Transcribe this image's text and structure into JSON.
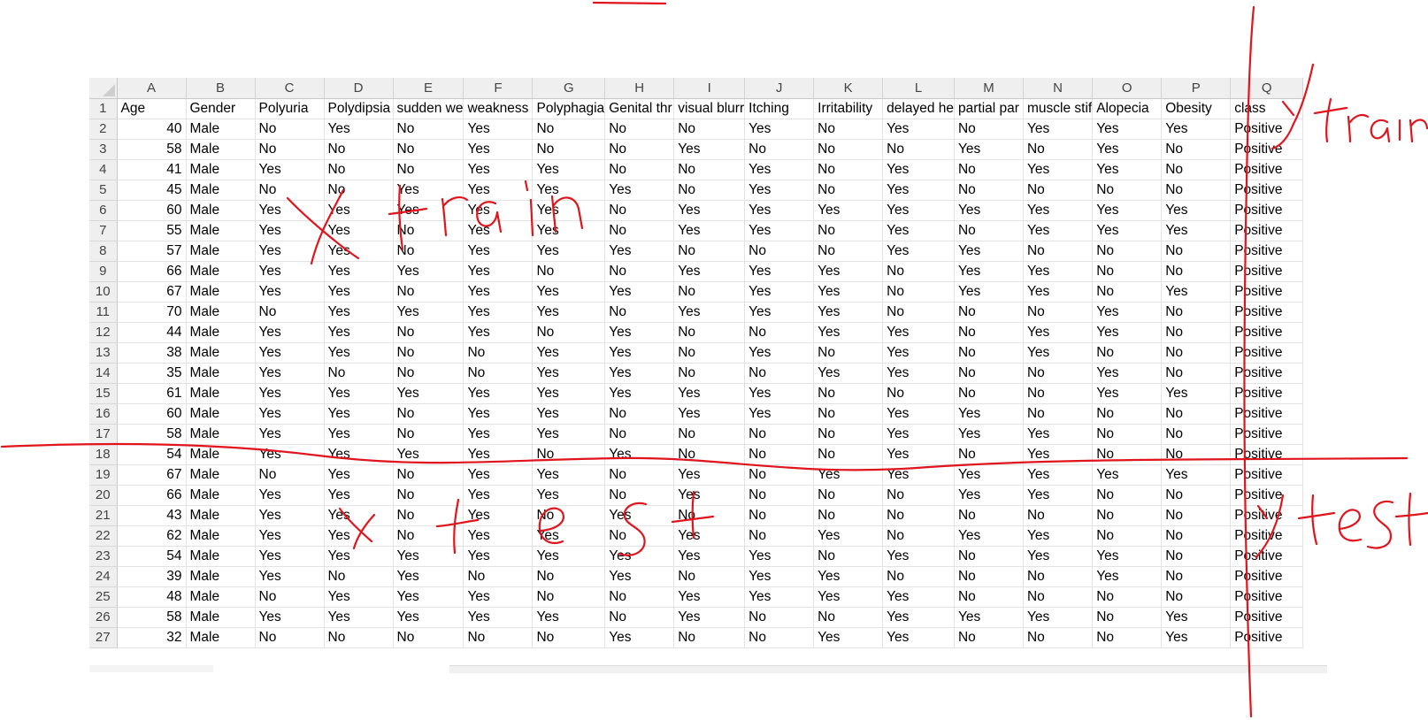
{
  "columns": [
    "A",
    "B",
    "C",
    "D",
    "E",
    "F",
    "G",
    "H",
    "I",
    "J",
    "K",
    "L",
    "M",
    "N",
    "O",
    "P",
    "Q"
  ],
  "header_row": [
    "Age",
    "Gender",
    "Polyuria",
    "Polydipsia",
    "sudden we",
    "weakness",
    "Polyphagia",
    "Genital thr",
    "visual blurr",
    "Itching",
    "Irritability",
    "delayed he",
    "partial par",
    "muscle stif",
    "Alopecia",
    "Obesity",
    "class"
  ],
  "rows": [
    [
      "40",
      "Male",
      "No",
      "Yes",
      "No",
      "Yes",
      "No",
      "No",
      "No",
      "Yes",
      "No",
      "Yes",
      "No",
      "Yes",
      "Yes",
      "Yes",
      "Positive"
    ],
    [
      "58",
      "Male",
      "No",
      "No",
      "No",
      "Yes",
      "No",
      "No",
      "Yes",
      "No",
      "No",
      "No",
      "Yes",
      "No",
      "Yes",
      "No",
      "Positive"
    ],
    [
      "41",
      "Male",
      "Yes",
      "No",
      "No",
      "Yes",
      "Yes",
      "No",
      "No",
      "Yes",
      "No",
      "Yes",
      "No",
      "Yes",
      "Yes",
      "No",
      "Positive"
    ],
    [
      "45",
      "Male",
      "No",
      "No",
      "Yes",
      "Yes",
      "Yes",
      "Yes",
      "No",
      "Yes",
      "No",
      "Yes",
      "No",
      "No",
      "No",
      "No",
      "Positive"
    ],
    [
      "60",
      "Male",
      "Yes",
      "Yes",
      "Yes",
      "Yes",
      "Yes",
      "No",
      "Yes",
      "Yes",
      "Yes",
      "Yes",
      "Yes",
      "Yes",
      "Yes",
      "Yes",
      "Positive"
    ],
    [
      "55",
      "Male",
      "Yes",
      "Yes",
      "No",
      "Yes",
      "Yes",
      "No",
      "Yes",
      "Yes",
      "No",
      "Yes",
      "No",
      "Yes",
      "Yes",
      "Yes",
      "Positive"
    ],
    [
      "57",
      "Male",
      "Yes",
      "Yes",
      "No",
      "Yes",
      "Yes",
      "Yes",
      "No",
      "No",
      "No",
      "Yes",
      "Yes",
      "No",
      "No",
      "No",
      "Positive"
    ],
    [
      "66",
      "Male",
      "Yes",
      "Yes",
      "Yes",
      "Yes",
      "No",
      "No",
      "Yes",
      "Yes",
      "Yes",
      "No",
      "Yes",
      "Yes",
      "No",
      "No",
      "Positive"
    ],
    [
      "67",
      "Male",
      "Yes",
      "Yes",
      "No",
      "Yes",
      "Yes",
      "Yes",
      "No",
      "Yes",
      "Yes",
      "No",
      "Yes",
      "Yes",
      "No",
      "Yes",
      "Positive"
    ],
    [
      "70",
      "Male",
      "No",
      "Yes",
      "Yes",
      "Yes",
      "Yes",
      "No",
      "Yes",
      "Yes",
      "Yes",
      "No",
      "No",
      "No",
      "Yes",
      "No",
      "Positive"
    ],
    [
      "44",
      "Male",
      "Yes",
      "Yes",
      "No",
      "Yes",
      "No",
      "Yes",
      "No",
      "No",
      "Yes",
      "Yes",
      "No",
      "Yes",
      "Yes",
      "No",
      "Positive"
    ],
    [
      "38",
      "Male",
      "Yes",
      "Yes",
      "No",
      "No",
      "Yes",
      "Yes",
      "No",
      "Yes",
      "No",
      "Yes",
      "No",
      "Yes",
      "No",
      "No",
      "Positive"
    ],
    [
      "35",
      "Male",
      "Yes",
      "No",
      "No",
      "No",
      "Yes",
      "Yes",
      "No",
      "No",
      "Yes",
      "Yes",
      "No",
      "No",
      "Yes",
      "No",
      "Positive"
    ],
    [
      "61",
      "Male",
      "Yes",
      "Yes",
      "Yes",
      "Yes",
      "Yes",
      "Yes",
      "Yes",
      "Yes",
      "No",
      "No",
      "No",
      "No",
      "Yes",
      "Yes",
      "Positive"
    ],
    [
      "60",
      "Male",
      "Yes",
      "Yes",
      "No",
      "Yes",
      "Yes",
      "No",
      "Yes",
      "Yes",
      "No",
      "Yes",
      "Yes",
      "No",
      "No",
      "No",
      "Positive"
    ],
    [
      "58",
      "Male",
      "Yes",
      "Yes",
      "No",
      "Yes",
      "Yes",
      "No",
      "No",
      "No",
      "No",
      "Yes",
      "Yes",
      "Yes",
      "No",
      "No",
      "Positive"
    ],
    [
      "54",
      "Male",
      "Yes",
      "Yes",
      "Yes",
      "Yes",
      "No",
      "Yes",
      "No",
      "No",
      "No",
      "Yes",
      "No",
      "Yes",
      "No",
      "No",
      "Positive"
    ],
    [
      "67",
      "Male",
      "No",
      "Yes",
      "No",
      "Yes",
      "Yes",
      "No",
      "Yes",
      "No",
      "Yes",
      "Yes",
      "Yes",
      "Yes",
      "Yes",
      "Yes",
      "Positive"
    ],
    [
      "66",
      "Male",
      "Yes",
      "Yes",
      "No",
      "Yes",
      "Yes",
      "No",
      "Yes",
      "No",
      "No",
      "No",
      "Yes",
      "Yes",
      "No",
      "No",
      "Positive"
    ],
    [
      "43",
      "Male",
      "Yes",
      "Yes",
      "No",
      "Yes",
      "No",
      "Yes",
      "No",
      "No",
      "No",
      "No",
      "No",
      "No",
      "No",
      "No",
      "Positive"
    ],
    [
      "62",
      "Male",
      "Yes",
      "Yes",
      "No",
      "Yes",
      "Yes",
      "No",
      "Yes",
      "No",
      "Yes",
      "No",
      "Yes",
      "Yes",
      "No",
      "No",
      "Positive"
    ],
    [
      "54",
      "Male",
      "Yes",
      "Yes",
      "Yes",
      "Yes",
      "Yes",
      "Yes",
      "Yes",
      "Yes",
      "No",
      "Yes",
      "No",
      "Yes",
      "Yes",
      "No",
      "Positive"
    ],
    [
      "39",
      "Male",
      "Yes",
      "No",
      "Yes",
      "No",
      "No",
      "Yes",
      "No",
      "Yes",
      "Yes",
      "No",
      "No",
      "No",
      "Yes",
      "No",
      "Positive"
    ],
    [
      "48",
      "Male",
      "No",
      "Yes",
      "Yes",
      "Yes",
      "No",
      "No",
      "Yes",
      "Yes",
      "Yes",
      "Yes",
      "No",
      "No",
      "No",
      "No",
      "Positive"
    ],
    [
      "58",
      "Male",
      "Yes",
      "Yes",
      "Yes",
      "Yes",
      "Yes",
      "No",
      "Yes",
      "No",
      "No",
      "Yes",
      "Yes",
      "Yes",
      "No",
      "Yes",
      "Positive"
    ],
    [
      "32",
      "Male",
      "No",
      "No",
      "No",
      "No",
      "No",
      "Yes",
      "No",
      "No",
      "Yes",
      "Yes",
      "No",
      "No",
      "No",
      "Yes",
      "Positive"
    ]
  ],
  "annotations": {
    "y_train": "y train",
    "x_train": "x train",
    "x_test": "x test",
    "y_test": "y test",
    "ink_color": "#e0141c"
  }
}
